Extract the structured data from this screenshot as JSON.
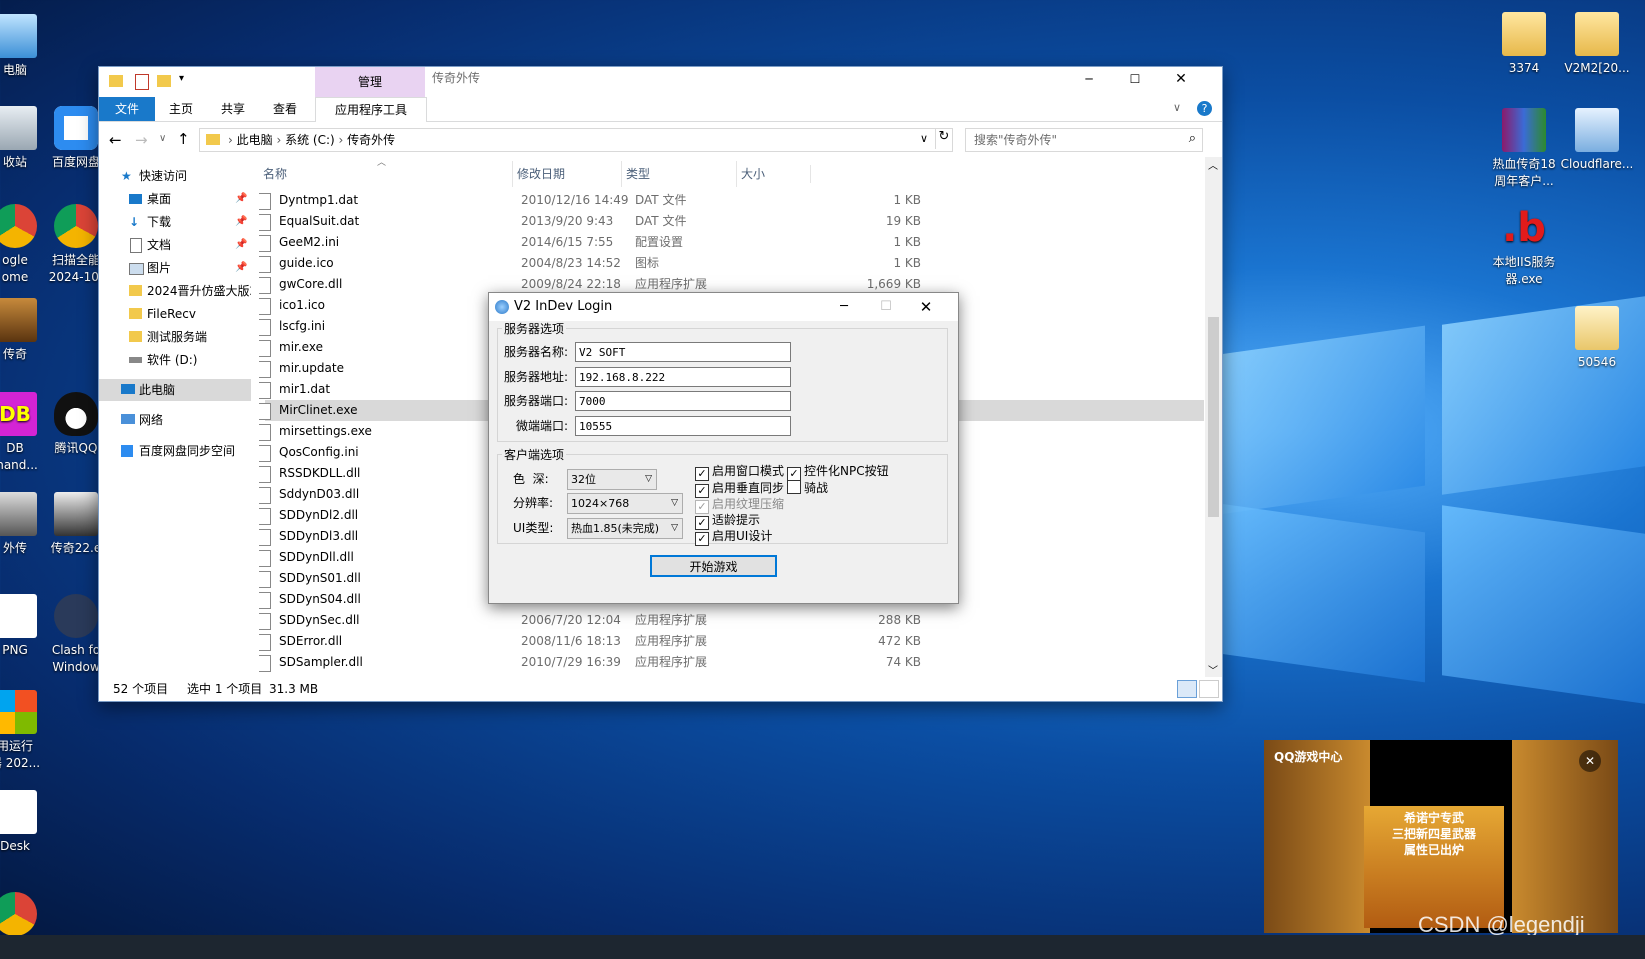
{
  "desktop": {
    "left_icons": [
      {
        "label": "电脑"
      },
      {
        "label": "收站"
      },
      {
        "label": "百度网盘"
      },
      {
        "label": "ogle\nome"
      },
      {
        "label": "扫描全能\n2024-10-"
      },
      {
        "label": "传奇"
      },
      {
        "label": "DB\nmand..."
      },
      {
        "label": "腾讯QQ"
      },
      {
        "label": "外传"
      },
      {
        "label": "传奇22.e"
      },
      {
        "label": "PNG"
      },
      {
        "label": "Clash fo\nWindow"
      },
      {
        "label": "用运行\n器 202..."
      },
      {
        "label": "Desk"
      }
    ],
    "right_icons": [
      {
        "label": "3374"
      },
      {
        "label": "V2M2[20..."
      },
      {
        "label": "热血传奇18\n周年客户..."
      },
      {
        "label": "Cloudflare..."
      },
      {
        "label": "本地IIS服务\n器.exe"
      },
      {
        "label": "50546"
      }
    ],
    "watermark": "CSDN @legendji"
  },
  "explorer": {
    "context_tab": "管理",
    "title": "传奇外传",
    "tabs": [
      "文件",
      "主页",
      "共享",
      "查看",
      "应用程序工具"
    ],
    "breadcrumb": [
      "此电脑",
      "系统 (C:)",
      "传奇外传"
    ],
    "search_placeholder": "搜索\"传奇外传\"",
    "nav": {
      "quick_access": "快速访问",
      "items": [
        "桌面",
        "下载",
        "文档",
        "图片",
        "2024晋升仿盛大版2",
        "FileRecv",
        "测试服务端",
        "软件 (D:)"
      ],
      "this_pc": "此电脑",
      "network": "网络",
      "baidu_sync": "百度网盘同步空间"
    },
    "columns": {
      "name": "名称",
      "date": "修改日期",
      "type": "类型",
      "size": "大小"
    },
    "files": [
      {
        "name": "Dyntmp1.dat",
        "date": "2010/12/16 14:49",
        "type": "DAT 文件",
        "size": "1 KB"
      },
      {
        "name": "EqualSuit.dat",
        "date": "2013/9/20 9:43",
        "type": "DAT 文件",
        "size": "19 KB"
      },
      {
        "name": "GeeM2.ini",
        "date": "2014/6/15 7:55",
        "type": "配置设置",
        "size": "1 KB"
      },
      {
        "name": "guide.ico",
        "date": "2004/8/23 14:52",
        "type": "图标",
        "size": "1 KB"
      },
      {
        "name": "gwCore.dll",
        "date": "2009/8/24 22:18",
        "type": "应用程序扩展",
        "size": "1,669 KB"
      },
      {
        "name": "ico1.ico",
        "date": "",
        "type": "",
        "size": ""
      },
      {
        "name": "lscfg.ini",
        "date": "",
        "type": "",
        "size": ""
      },
      {
        "name": "mir.exe",
        "date": "",
        "type": "",
        "size": ""
      },
      {
        "name": "mir.update",
        "date": "",
        "type": "",
        "size": ""
      },
      {
        "name": "mir1.dat",
        "date": "",
        "type": "",
        "size": ""
      },
      {
        "name": "MirClinet.exe",
        "date": "",
        "type": "",
        "size": ""
      },
      {
        "name": "mirsettings.exe",
        "date": "",
        "type": "",
        "size": ""
      },
      {
        "name": "QosConfig.ini",
        "date": "",
        "type": "",
        "size": ""
      },
      {
        "name": "RSSDKDLL.dll",
        "date": "",
        "type": "",
        "size": ""
      },
      {
        "name": "SddynD03.dll",
        "date": "",
        "type": "",
        "size": ""
      },
      {
        "name": "SDDynDl2.dll",
        "date": "",
        "type": "",
        "size": ""
      },
      {
        "name": "SDDynDl3.dll",
        "date": "",
        "type": "",
        "size": ""
      },
      {
        "name": "SDDynDll.dll",
        "date": "",
        "type": "",
        "size": ""
      },
      {
        "name": "SDDynS01.dll",
        "date": "",
        "type": "",
        "size": ""
      },
      {
        "name": "SDDynS04.dll",
        "date": "",
        "type": "",
        "size": ""
      },
      {
        "name": "SDDynSec.dll",
        "date": "2006/7/20 12:04",
        "type": "应用程序扩展",
        "size": "288 KB"
      },
      {
        "name": "SDError.dll",
        "date": "2008/11/6 18:13",
        "type": "应用程序扩展",
        "size": "472 KB"
      },
      {
        "name": "SDSampler.dll",
        "date": "2010/7/29 16:39",
        "type": "应用程序扩展",
        "size": "74 KB"
      }
    ],
    "status": {
      "count": "52 个项目",
      "selected": "选中 1 个项目",
      "size": "31.3 MB"
    }
  },
  "login": {
    "title": "V2 InDev Login",
    "server_group": "服务器选项",
    "server_name_label": "服务器名称:",
    "server_name": "V2 SOFT",
    "server_addr_label": "服务器地址:",
    "server_addr": "192.168.8.222",
    "server_port_label": "服务器端口:",
    "server_port": "7000",
    "micro_port_label": "微端端口:",
    "micro_port": "10555",
    "client_group": "客户端选项",
    "color_label": "色  深:",
    "color_value": "32位",
    "res_label": "分辨率:",
    "res_value": "1024×768",
    "ui_label": "UI类型:",
    "ui_value": "热血1.85(未完成)",
    "checks": {
      "window_mode": "启用窗口模式",
      "npc_button": "控件化NPC按钮",
      "vsync": "启用垂直同步",
      "horse": "骑战",
      "texture": "启用纹理压缩",
      "age_tip": "适龄提示",
      "ui_design": "启用UI设计"
    },
    "start_button": "开始游戏"
  },
  "qq_popup": {
    "brand": "QQ游戏中心",
    "ad_text_1": "希诺宁专武",
    "ad_text_2": "三把新四星武器",
    "ad_text_3": "属性已出炉"
  }
}
